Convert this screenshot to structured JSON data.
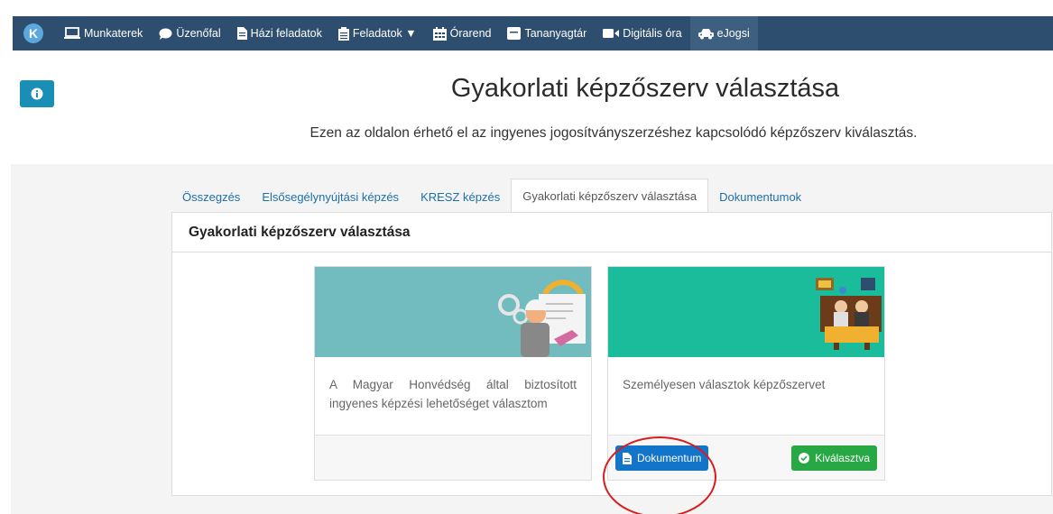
{
  "nav": {
    "logo": "K",
    "items": [
      {
        "label": "Munkaterek",
        "icon": "laptop-icon"
      },
      {
        "label": "Üzenőfal",
        "icon": "comment-icon"
      },
      {
        "label": "Házi feladatok",
        "icon": "file-icon"
      },
      {
        "label": "Feladatok ▼",
        "icon": "clipboard-icon"
      },
      {
        "label": "Órarend",
        "icon": "calendar-icon"
      },
      {
        "label": "Tananyagtár",
        "icon": "book-icon"
      },
      {
        "label": "Digitális óra",
        "icon": "video-icon"
      },
      {
        "label": "eJogsi",
        "icon": "car-icon"
      }
    ],
    "active_index": 7
  },
  "page": {
    "title": "Gyakorlati képzőszerv választása",
    "subtitle": "Ezen az oldalon érhető el az ingyenes jogosítványszerzéshez kapcsolódó képzőszerv kiválasztás."
  },
  "tabs": [
    {
      "label": "Összegzés",
      "active": false
    },
    {
      "label": "Elsősegélynyújtási képzés",
      "active": false
    },
    {
      "label": "KRESZ képzés",
      "active": false
    },
    {
      "label": "Gyakorlati képzőszerv választása",
      "active": true
    },
    {
      "label": "Dokumentumok",
      "active": false
    }
  ],
  "panel": {
    "heading": "Gyakorlati képzőszerv választása"
  },
  "cards": [
    {
      "text": "A Magyar Honvédség által biztosított ingyenes képzési lehetőséget választom",
      "banner_color": "#72bcc0"
    },
    {
      "text": "Személyesen választok képzőszervet",
      "banner_color": "#1bbc9b",
      "document_button": "Dokumentum",
      "selected_button": "Kiválasztva"
    }
  ],
  "colors": {
    "navbar": "#2d4e6e",
    "info_button": "#1a8fb6",
    "link": "#1e6fa8",
    "primary_button": "#1275c9",
    "success_button": "#28a745",
    "highlight_circle": "#d91c1c"
  }
}
